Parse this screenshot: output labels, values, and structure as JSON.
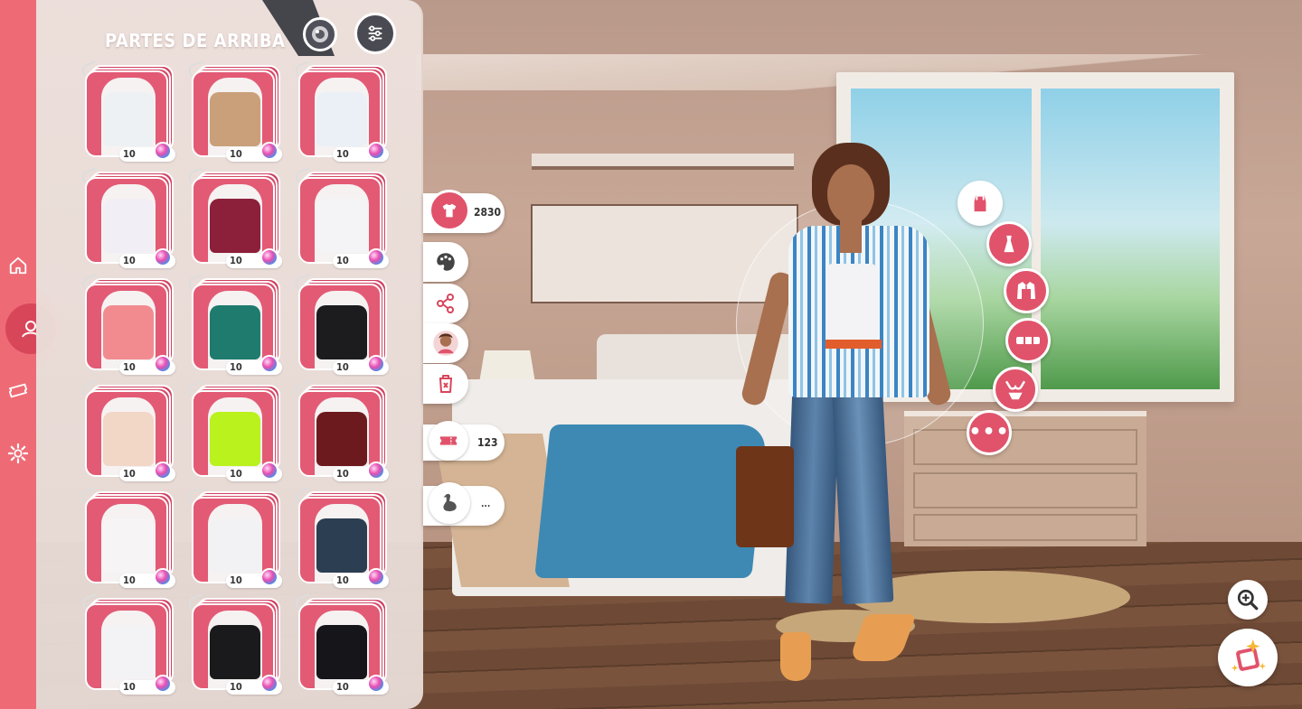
{
  "panel": {
    "category_title": "PARTES DE ARRIBA",
    "category_chevron_icon": "chevron-down-icon",
    "color_button_icon": "color-wheel-icon",
    "filter_button_icon": "sliders-icon"
  },
  "left_nav": {
    "items": [
      {
        "icon": "home-icon",
        "active": false
      },
      {
        "icon": "avatar-icon",
        "active": true
      },
      {
        "icon": "ticket-icon",
        "active": false
      },
      {
        "icon": "gear-icon",
        "active": false
      }
    ],
    "accent_color": "#ee6b75"
  },
  "items": [
    {
      "name": "white-corset-top",
      "price": "10",
      "color": "#eef1f4"
    },
    {
      "name": "crochet-bikini-top",
      "price": "10",
      "color": "#c9a07a"
    },
    {
      "name": "white-puff-blouse",
      "price": "10",
      "color": "#eaf0f6"
    },
    {
      "name": "white-tee",
      "price": "10",
      "color": "#f1eef6"
    },
    {
      "name": "burgundy-lace-babydoll",
      "price": "10",
      "color": "#8c1f3a"
    },
    {
      "name": "white-ruffle-blouse",
      "price": "10",
      "color": "#f4f4f6"
    },
    {
      "name": "pink-bow-top",
      "price": "10",
      "color": "#f28b8f"
    },
    {
      "name": "teal-sports-bra",
      "price": "10",
      "color": "#1e7b6d"
    },
    {
      "name": "black-cami",
      "price": "10",
      "color": "#1c1c1e"
    },
    {
      "name": "peach-tie-shirt",
      "price": "10",
      "color": "#f2d6c6"
    },
    {
      "name": "neon-green-crop",
      "price": "10",
      "color": "#b9f21c"
    },
    {
      "name": "maroon-graphic-tee",
      "price": "10",
      "color": "#6d1a1f"
    },
    {
      "name": "white-heart-cutout",
      "price": "10",
      "color": "#f6f4f5"
    },
    {
      "name": "white-button-shirt",
      "price": "10",
      "color": "#f2f2f4"
    },
    {
      "name": "navy-corset",
      "price": "10",
      "color": "#2c3e52"
    },
    {
      "name": "white-bustier",
      "price": "10",
      "color": "#f3f3f6"
    },
    {
      "name": "black-offshoulder-mesh",
      "price": "10",
      "color": "#1a1a1c"
    },
    {
      "name": "black-cardigan",
      "price": "10",
      "color": "#15151a"
    }
  ],
  "side_counters": {
    "clothes_count": "2830",
    "tickets_count": "123",
    "pet_count": "..."
  },
  "side_buttons": [
    {
      "icon": "palette-icon"
    },
    {
      "icon": "share-icon"
    },
    {
      "icon": "portrait-icon"
    },
    {
      "icon": "trash-icon"
    }
  ],
  "radial_categories": [
    {
      "icon": "tank-top-icon"
    },
    {
      "icon": "dress-icon"
    },
    {
      "icon": "jacket-icon"
    },
    {
      "icon": "belt-icon"
    },
    {
      "icon": "lingerie-icon"
    },
    {
      "icon": "more-icon",
      "label": "•••"
    }
  ],
  "bottom_right": {
    "zoom_icon": "zoom-in-icon",
    "looks_icon": "looks-sparkle-icon"
  }
}
